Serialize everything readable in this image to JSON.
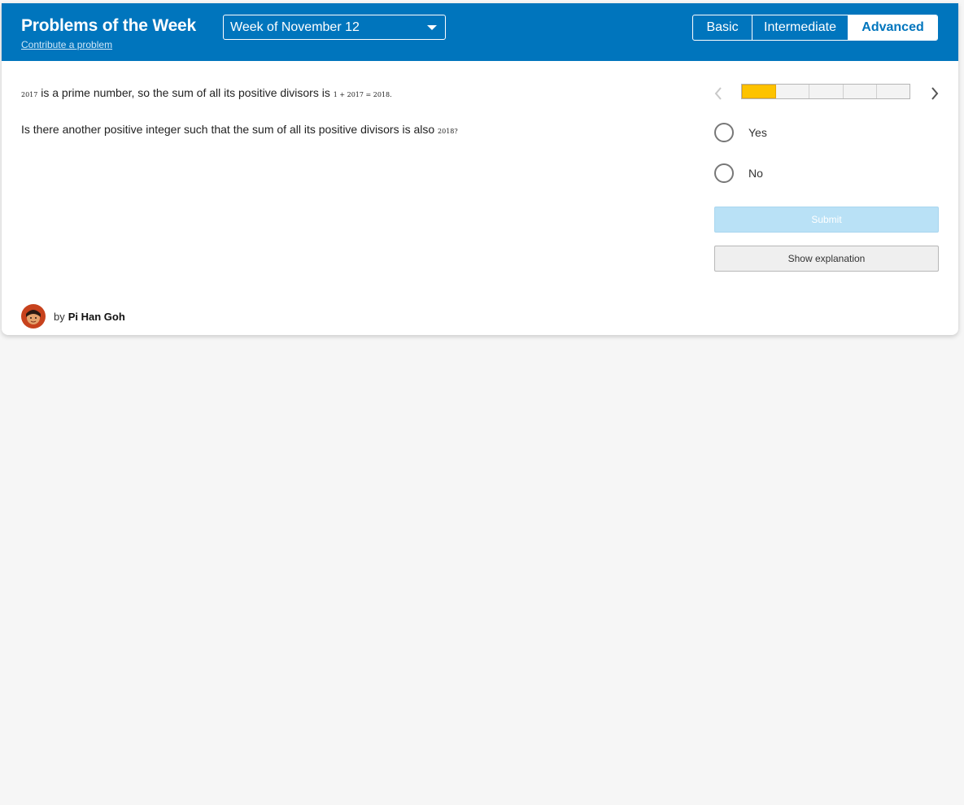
{
  "header": {
    "title": "Problems of the Week",
    "contribute_link": "Contribute a problem",
    "week_selected": "Week of November 12",
    "levels": [
      {
        "label": "Basic",
        "active": false
      },
      {
        "label": "Intermediate",
        "active": false
      },
      {
        "label": "Advanced",
        "active": true
      }
    ]
  },
  "problem": {
    "line1": {
      "math_a": "2017",
      "text": " is a prime number, so the sum of all its positive divisors is ",
      "math_b": "1 + 2017 = 2018."
    },
    "line2": {
      "text": "Is there another positive integer such that the sum of all its positive divisors is also ",
      "math": "2018?"
    }
  },
  "progress": {
    "segments": 5,
    "current": 1
  },
  "options": [
    {
      "label": "Yes"
    },
    {
      "label": "No"
    }
  ],
  "buttons": {
    "submit": "Submit",
    "explanation": "Show explanation"
  },
  "author": {
    "prefix": "by",
    "name": "Pi Han Goh"
  },
  "colors": {
    "header_bg": "#0075bd",
    "progress_fill": "#fdc300",
    "submit_disabled": "#b9e1f6",
    "page_bg": "#f6f6f6"
  }
}
